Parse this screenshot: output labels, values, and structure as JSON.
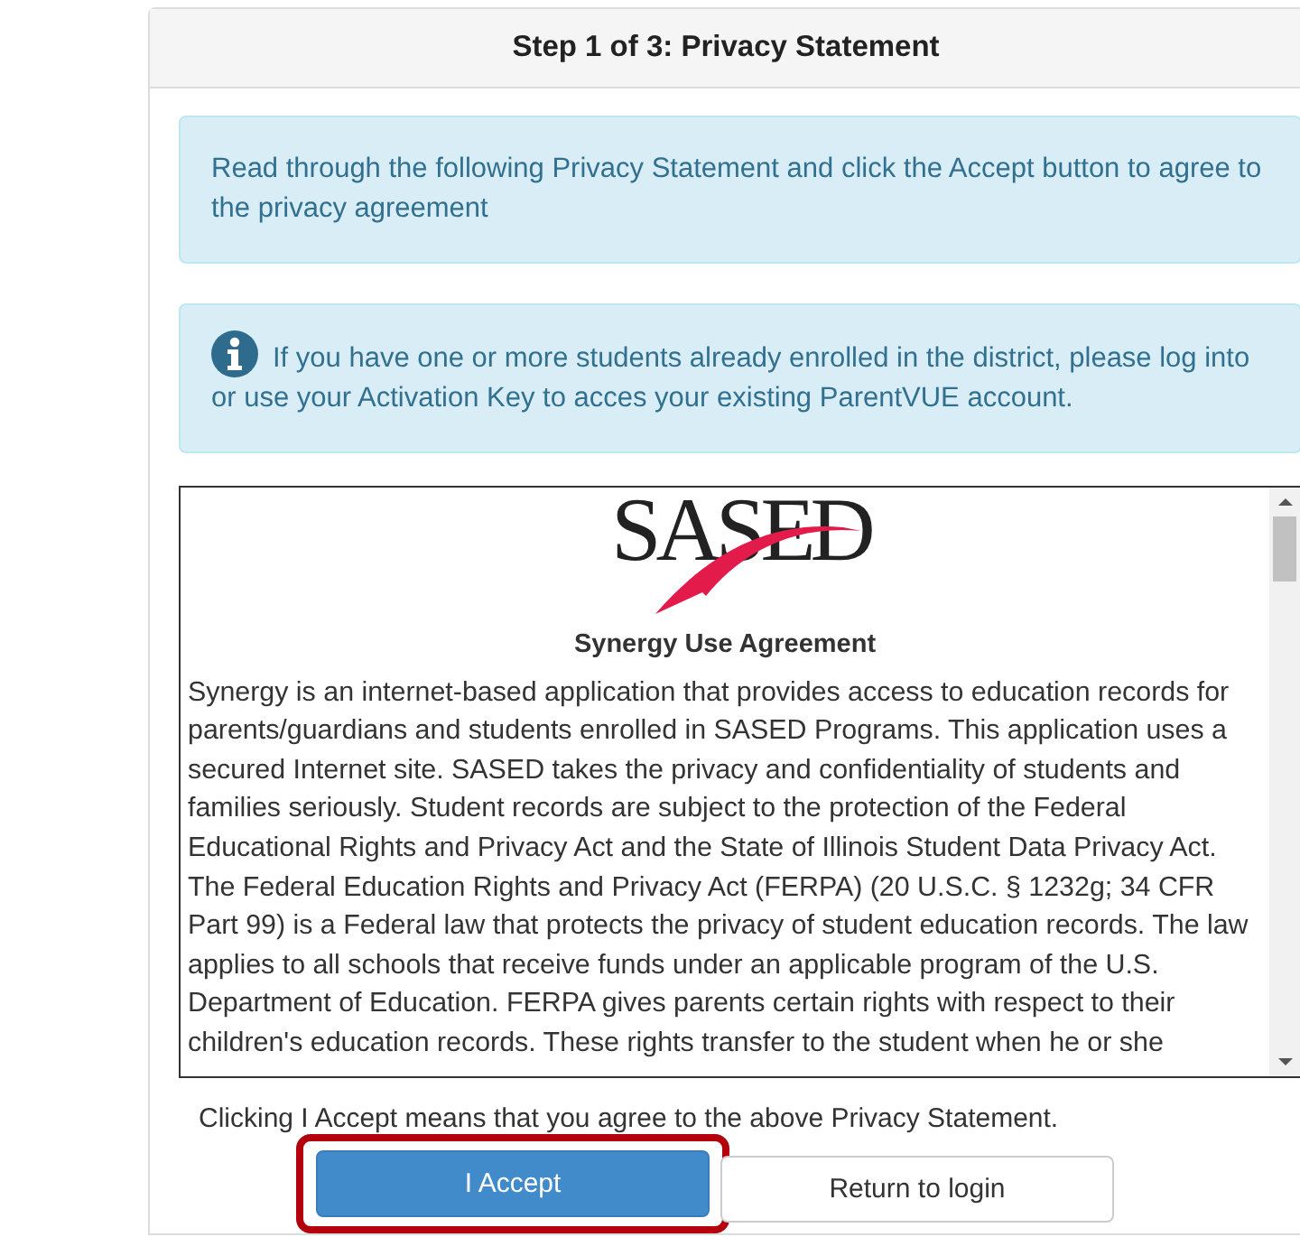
{
  "panel": {
    "title": "Step 1 of 3: Privacy Statement"
  },
  "alerts": [
    {
      "kind": "plain",
      "text": "Read through the following Privacy Statement and click the Accept button to agree to the privacy agreement"
    },
    {
      "kind": "info",
      "text": "If you have one or more students already enrolled in the district, please log into or use your Activation Key to acces your existing ParentVUE account."
    }
  ],
  "agreement": {
    "logo": "SASED",
    "title": "Synergy Use Agreement",
    "text": "Synergy is an internet-based application that provides access to education records for parents/guardians and students enrolled in SASED Programs. This application uses a secured Internet site. SASED takes the privacy and confidentiality of students and families seriously. Student records are subject to the protection of the Federal Educational Rights and Privacy Act and the State of Illinois Student Data Privacy Act. The Federal Education Rights and Privacy Act (FERPA) (20 U.S.C. § 1232g; 34 CFR Part 99) is a Federal law that protects the privacy of student education records. The law applies to all schools that receive funds under an applicable program of the U.S. Department of Education. FERPA gives parents certain rights with respect to their children's education records. These rights transfer to the student when he or she"
  },
  "notice": "Clicking I Accept means that you agree to the above Privacy Statement.",
  "buttons": [
    {
      "kind": "primary",
      "label": "I Accept",
      "highlighted": true
    },
    {
      "kind": "default",
      "label": "Return to login",
      "highlighted": false
    }
  ]
}
